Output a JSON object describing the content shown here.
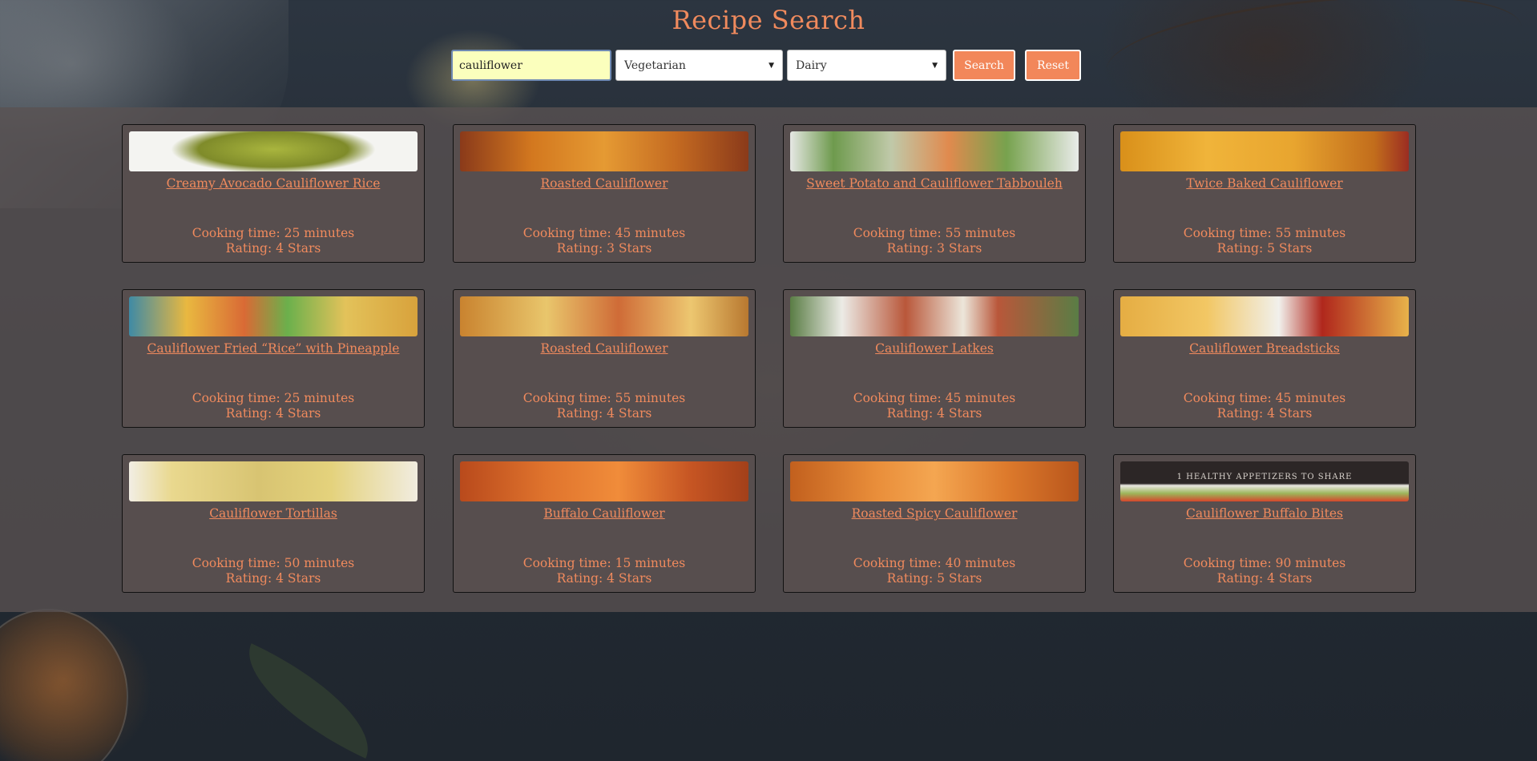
{
  "header": {
    "title": "Recipe Search",
    "search_value": "cauliflower",
    "diet_selected": "Vegetarian",
    "intolerance_selected": "Dairy",
    "search_label": "Search",
    "reset_label": "Reset"
  },
  "colors": {
    "accent": "#f08a5d",
    "input_bg": "#fbffbd",
    "card_bg": "#574e4e"
  },
  "recipes": [
    {
      "title": "Creamy Avocado Cauliflower Rice",
      "time": "Cooking time: 25 minutes",
      "rating": "Rating: 4 Stars"
    },
    {
      "title": "Roasted Cauliflower",
      "time": "Cooking time: 45 minutes",
      "rating": "Rating: 3 Stars"
    },
    {
      "title": "Sweet Potato and Cauliflower Tabbouleh",
      "time": "Cooking time: 55 minutes",
      "rating": "Rating: 3 Stars"
    },
    {
      "title": "Twice Baked Cauliflower",
      "time": "Cooking time: 55 minutes",
      "rating": "Rating: 5 Stars"
    },
    {
      "title": "Cauliflower Fried “Rice” with Pineapple",
      "time": "Cooking time: 25 minutes",
      "rating": "Rating: 4 Stars"
    },
    {
      "title": "Roasted Cauliflower",
      "time": "Cooking time: 55 minutes",
      "rating": "Rating: 4 Stars"
    },
    {
      "title": "Cauliflower Latkes",
      "time": "Cooking time: 45 minutes",
      "rating": "Rating: 4 Stars"
    },
    {
      "title": "Cauliflower Breadsticks",
      "time": "Cooking time: 45 minutes",
      "rating": "Rating: 4 Stars"
    },
    {
      "title": "Cauliflower Tortillas",
      "time": "Cooking time: 50 minutes",
      "rating": "Rating: 4 Stars"
    },
    {
      "title": "Buffalo Cauliflower",
      "time": "Cooking time: 15 minutes",
      "rating": "Rating: 4 Stars"
    },
    {
      "title": "Roasted Spicy Cauliflower",
      "time": "Cooking time: 40 minutes",
      "rating": "Rating: 5 Stars"
    },
    {
      "title": "Cauliflower Buffalo Bites",
      "time": "Cooking time: 90 minutes",
      "rating": "Rating: 4 Stars"
    }
  ],
  "thumb_caption_12": "1 HEALTHY APPETIZERS TO SHARE"
}
